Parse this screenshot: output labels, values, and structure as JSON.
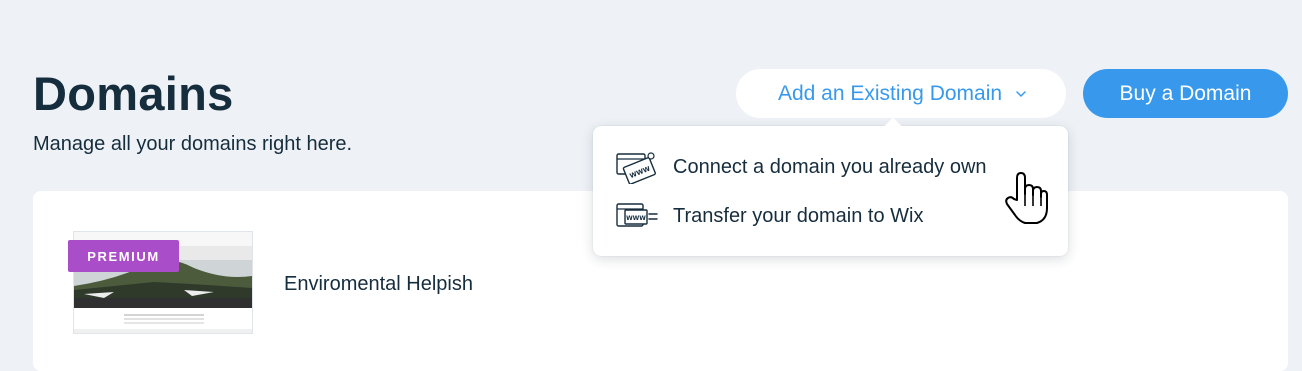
{
  "header": {
    "title": "Domains",
    "subtitle": "Manage all your domains right here."
  },
  "actions": {
    "existing_domain_label": "Add an Existing Domain",
    "buy_domain_label": "Buy a Domain"
  },
  "dropdown": {
    "items": [
      {
        "label": "Connect a domain you already own",
        "icon": "www-card-connect-icon",
        "icon_text": "WWW"
      },
      {
        "label": "Transfer your domain to Wix",
        "icon": "www-transfer-icon",
        "icon_text": "WWW"
      }
    ]
  },
  "site": {
    "name": "Enviromental Helpish",
    "plan_badge": "PREMIUM"
  },
  "colors": {
    "background": "#eef2f6",
    "primary_blue": "#3899ec",
    "text_dark": "#162d3d",
    "premium_purple": "#aa4dc8"
  }
}
